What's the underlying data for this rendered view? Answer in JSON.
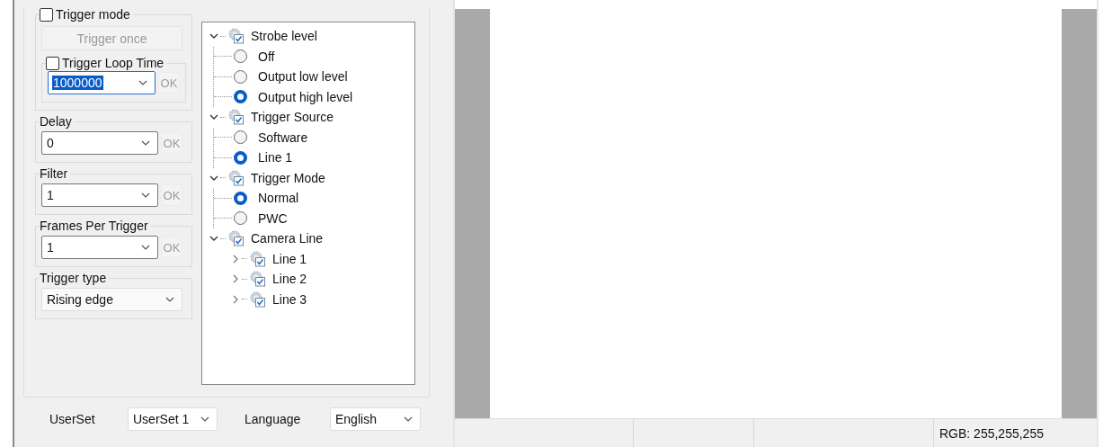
{
  "trigger_mode": {
    "label": "Trigger mode",
    "checked": false,
    "trigger_once": {
      "label": "Trigger once",
      "disabled": true
    },
    "loop_time": {
      "label": "Trigger Loop Time",
      "checked": false,
      "value": "1000000",
      "value_selected": true,
      "ok": {
        "label": "OK",
        "disabled": true
      }
    }
  },
  "fields": [
    {
      "label": "Delay",
      "value": "0",
      "ok": {
        "label": "OK",
        "disabled": true
      }
    },
    {
      "label": "Filter",
      "value": "1",
      "ok": {
        "label": "OK",
        "disabled": true
      }
    },
    {
      "label": "Frames Per Trigger",
      "value": "1",
      "ok": {
        "label": "OK",
        "disabled": true
      }
    },
    {
      "label": "Trigger type",
      "value": "Rising edge"
    }
  ],
  "tree": [
    {
      "label": "Strobe level",
      "expanded": true,
      "children": [
        {
          "kind": "radio",
          "label": "Off",
          "selected": false
        },
        {
          "kind": "radio",
          "label": "Output low level",
          "selected": false
        },
        {
          "kind": "radio",
          "label": "Output high level",
          "selected": true
        }
      ]
    },
    {
      "label": "Trigger Source",
      "expanded": true,
      "children": [
        {
          "kind": "radio",
          "label": "Software",
          "selected": false
        },
        {
          "kind": "radio",
          "label": "Line 1",
          "selected": true
        }
      ]
    },
    {
      "label": "Trigger Mode",
      "expanded": true,
      "children": [
        {
          "kind": "radio",
          "label": "Normal",
          "selected": true
        },
        {
          "kind": "radio",
          "label": "PWC",
          "selected": false
        }
      ]
    },
    {
      "label": "Camera Line",
      "expanded": true,
      "children": [
        {
          "kind": "node",
          "label": "Line 1",
          "expanded": false
        },
        {
          "kind": "node",
          "label": "Line 2",
          "expanded": false
        },
        {
          "kind": "node",
          "label": "Line 3",
          "expanded": false
        }
      ]
    }
  ],
  "bottom": {
    "userset_label": "UserSet",
    "userset_value": "UserSet 1",
    "language_label": "Language",
    "language_value": "English"
  },
  "status_bar": {
    "rgb": "RGB: 255,255,255"
  }
}
